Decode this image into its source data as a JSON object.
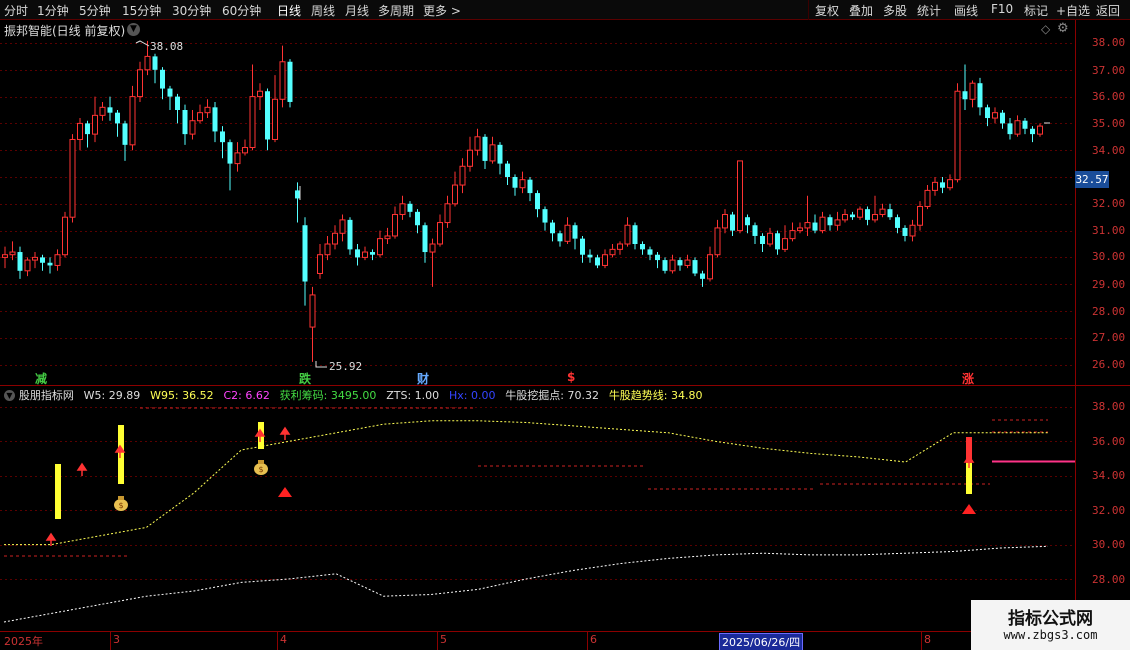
{
  "toolbar": {
    "periods": [
      "分时",
      "1分钟",
      "5分钟",
      "15分钟",
      "30分钟",
      "60分钟",
      "日线",
      "周线",
      "月线",
      "多周期",
      "更多 >"
    ],
    "active_period": "日线",
    "right_buttons": [
      "复权",
      "叠加",
      "多股",
      "统计",
      "画线",
      "F10",
      "标记",
      "+自选",
      "返回"
    ]
  },
  "main_chart": {
    "title": "振邦智能(日线 前复权)",
    "high_label": "38.08",
    "low_label": "25.92",
    "current_price": "32.57",
    "y_ticks": [
      "38.00",
      "37.00",
      "36.00",
      "35.00",
      "34.00",
      "33.00",
      "32.00",
      "31.00",
      "30.00",
      "29.00",
      "28.00",
      "27.00",
      "26.00"
    ],
    "markers": [
      {
        "text": "减",
        "color": "#44cc44"
      },
      {
        "text": "跌",
        "color": "#44cc44"
      },
      {
        "text": "财",
        "color": "#66aaff"
      },
      {
        "text": "$",
        "color": "#ff3333"
      },
      {
        "text": "涨",
        "color": "#ff3333"
      }
    ]
  },
  "indicator": {
    "name": "股朋指标网",
    "items": [
      {
        "text": "W5: 29.89",
        "color": "#dddddd"
      },
      {
        "text": "W95: 36.52",
        "color": "#ffff55"
      },
      {
        "text": "C2: 6.62",
        "color": "#ff44ff"
      },
      {
        "text": "获利筹码: 3495.00",
        "color": "#44dd44"
      },
      {
        "text": "ZTS: 1.00",
        "color": "#dddddd"
      },
      {
        "text": "Hx: 0.00",
        "color": "#3344ff"
      },
      {
        "text": "牛股挖掘点: 70.32",
        "color": "#dddddd"
      },
      {
        "text": "牛股趋势线: 34.80",
        "color": "#ffff55"
      }
    ],
    "y_ticks": [
      "38.00",
      "36.00",
      "34.00",
      "32.00",
      "30.00",
      "28.00"
    ]
  },
  "dates": {
    "labels": [
      "2025年",
      "3",
      "4",
      "5",
      "6",
      "8"
    ],
    "selected": "2025/06/26/四"
  },
  "watermark": {
    "title": "指标公式网",
    "url": "www.zbgs3.com"
  },
  "chart_data": {
    "type": "candlestick",
    "title": "振邦智能(日线 前复权)",
    "ylim": [
      25.5,
      38.5
    ],
    "up_color": "#ff3333",
    "down_color": "#54ffff",
    "candles": [
      [
        30.0,
        30.1,
        29.6,
        30.4
      ],
      [
        30.1,
        30.2,
        29.9,
        30.6
      ],
      [
        30.2,
        29.5,
        29.2,
        30.4
      ],
      [
        29.5,
        29.9,
        29.3,
        30.0
      ],
      [
        29.9,
        30.0,
        29.6,
        30.2
      ],
      [
        30.0,
        29.8,
        29.5,
        30.1
      ],
      [
        29.8,
        29.7,
        29.4,
        30.0
      ],
      [
        29.7,
        30.1,
        29.5,
        30.3
      ],
      [
        30.1,
        31.5,
        30.0,
        31.7
      ],
      [
        31.5,
        34.4,
        31.3,
        34.6
      ],
      [
        34.4,
        35.0,
        34.0,
        35.2
      ],
      [
        35.0,
        34.6,
        34.1,
        35.1
      ],
      [
        34.6,
        35.3,
        34.3,
        36.0
      ],
      [
        35.3,
        35.6,
        35.1,
        35.8
      ],
      [
        35.6,
        35.4,
        35.1,
        36.0
      ],
      [
        35.4,
        35.0,
        34.5,
        35.5
      ],
      [
        35.0,
        34.2,
        33.6,
        35.1
      ],
      [
        34.2,
        36.0,
        34.0,
        36.4
      ],
      [
        36.0,
        37.0,
        35.8,
        37.3
      ],
      [
        37.0,
        37.5,
        36.8,
        38.08
      ],
      [
        37.5,
        37.0,
        36.5,
        37.6
      ],
      [
        37.0,
        36.3,
        35.9,
        37.1
      ],
      [
        36.3,
        36.0,
        35.5,
        36.4
      ],
      [
        36.0,
        35.5,
        35.0,
        36.1
      ],
      [
        35.5,
        34.6,
        34.2,
        35.7
      ],
      [
        34.6,
        35.1,
        34.4,
        35.5
      ],
      [
        35.1,
        35.4,
        35.0,
        35.7
      ],
      [
        35.4,
        35.6,
        35.2,
        35.9
      ],
      [
        35.6,
        34.7,
        34.3,
        35.8
      ],
      [
        34.7,
        34.3,
        33.7,
        34.9
      ],
      [
        34.3,
        33.5,
        32.5,
        34.4
      ],
      [
        33.5,
        33.9,
        33.2,
        34.3
      ],
      [
        33.9,
        34.1,
        33.8,
        34.4
      ],
      [
        34.1,
        36.0,
        34.0,
        37.2
      ],
      [
        36.0,
        36.2,
        35.5,
        36.5
      ],
      [
        36.2,
        34.4,
        34.0,
        36.3
      ],
      [
        34.4,
        35.9,
        34.3,
        36.8
      ],
      [
        35.9,
        37.3,
        35.6,
        37.9
      ],
      [
        37.3,
        35.8,
        35.6,
        37.4
      ],
      [
        32.5,
        32.2,
        31.3,
        32.8
      ],
      [
        31.2,
        29.1,
        28.2,
        31.5
      ],
      [
        27.4,
        28.6,
        26.1,
        28.9
      ],
      [
        29.4,
        30.1,
        29.2,
        30.5
      ],
      [
        30.1,
        30.5,
        29.9,
        30.8
      ],
      [
        30.5,
        30.9,
        30.3,
        31.2
      ],
      [
        30.9,
        31.4,
        30.6,
        31.6
      ],
      [
        31.4,
        30.3,
        30.1,
        31.5
      ],
      [
        30.3,
        30.0,
        29.7,
        30.5
      ],
      [
        30.0,
        30.2,
        29.9,
        30.4
      ],
      [
        30.2,
        30.1,
        29.9,
        30.3
      ],
      [
        30.1,
        30.7,
        30.0,
        31.0
      ],
      [
        30.7,
        30.8,
        30.5,
        31.1
      ],
      [
        30.8,
        31.6,
        30.7,
        31.9
      ],
      [
        31.6,
        32.0,
        31.4,
        32.3
      ],
      [
        32.0,
        31.7,
        31.5,
        32.1
      ],
      [
        31.7,
        31.2,
        30.9,
        31.8
      ],
      [
        31.2,
        30.2,
        29.8,
        31.3
      ],
      [
        30.2,
        30.5,
        28.9,
        30.7
      ],
      [
        30.5,
        31.3,
        30.4,
        31.6
      ],
      [
        31.3,
        32.0,
        31.1,
        32.3
      ],
      [
        32.0,
        32.7,
        31.9,
        33.2
      ],
      [
        32.7,
        33.4,
        32.4,
        33.7
      ],
      [
        33.4,
        34.0,
        33.2,
        34.5
      ],
      [
        34.0,
        34.5,
        33.8,
        34.8
      ],
      [
        34.5,
        33.6,
        33.3,
        34.6
      ],
      [
        33.6,
        34.2,
        33.5,
        34.5
      ],
      [
        34.2,
        33.5,
        33.1,
        34.3
      ],
      [
        33.5,
        33.0,
        32.7,
        33.6
      ],
      [
        33.0,
        32.6,
        32.3,
        33.1
      ],
      [
        32.6,
        32.9,
        32.4,
        33.2
      ],
      [
        32.9,
        32.4,
        32.1,
        33.0
      ],
      [
        32.4,
        31.8,
        31.5,
        32.5
      ],
      [
        31.8,
        31.3,
        31.0,
        31.9
      ],
      [
        31.3,
        30.9,
        30.6,
        31.4
      ],
      [
        30.9,
        30.6,
        30.4,
        31.0
      ],
      [
        30.6,
        31.2,
        30.5,
        31.5
      ],
      [
        31.2,
        30.7,
        30.3,
        31.3
      ],
      [
        30.7,
        30.1,
        29.8,
        30.8
      ],
      [
        30.1,
        30.0,
        29.8,
        30.3
      ],
      [
        30.0,
        29.7,
        29.6,
        30.1
      ],
      [
        29.7,
        30.1,
        29.6,
        30.3
      ],
      [
        30.1,
        30.3,
        30.0,
        30.5
      ],
      [
        30.3,
        30.5,
        30.1,
        30.6
      ],
      [
        30.5,
        31.2,
        30.4,
        31.5
      ],
      [
        31.2,
        30.5,
        30.3,
        31.3
      ],
      [
        30.5,
        30.3,
        30.1,
        30.6
      ],
      [
        30.3,
        30.1,
        29.9,
        30.4
      ],
      [
        30.1,
        29.9,
        29.6,
        30.2
      ],
      [
        29.9,
        29.5,
        29.4,
        30.0
      ],
      [
        29.5,
        29.9,
        29.4,
        30.1
      ],
      [
        29.9,
        29.7,
        29.5,
        30.0
      ],
      [
        29.7,
        29.9,
        29.6,
        30.1
      ],
      [
        29.9,
        29.4,
        29.3,
        30.0
      ],
      [
        29.4,
        29.2,
        28.9,
        29.5
      ],
      [
        29.2,
        30.1,
        29.1,
        30.4
      ],
      [
        30.1,
        31.1,
        30.0,
        31.4
      ],
      [
        31.1,
        31.6,
        30.9,
        31.8
      ],
      [
        31.6,
        31.0,
        30.8,
        31.7
      ],
      [
        31.0,
        33.6,
        30.9,
        33.6
      ],
      [
        31.5,
        31.2,
        30.9,
        31.6
      ],
      [
        31.2,
        30.8,
        30.5,
        31.3
      ],
      [
        30.8,
        30.5,
        30.2,
        30.9
      ],
      [
        30.5,
        30.9,
        30.4,
        31.1
      ],
      [
        30.9,
        30.3,
        30.1,
        31.0
      ],
      [
        30.3,
        30.7,
        30.2,
        31.2
      ],
      [
        30.7,
        31.0,
        30.6,
        31.3
      ],
      [
        31.0,
        31.1,
        30.9,
        31.3
      ],
      [
        31.1,
        31.3,
        30.8,
        32.3
      ],
      [
        31.3,
        31.0,
        30.9,
        31.6
      ],
      [
        31.0,
        31.5,
        30.9,
        31.7
      ],
      [
        31.5,
        31.2,
        31.0,
        31.6
      ],
      [
        31.2,
        31.4,
        31.0,
        31.7
      ],
      [
        31.4,
        31.6,
        31.3,
        31.8
      ],
      [
        31.6,
        31.5,
        31.4,
        31.7
      ],
      [
        31.5,
        31.8,
        31.4,
        31.9
      ],
      [
        31.8,
        31.4,
        31.2,
        31.9
      ],
      [
        31.4,
        31.6,
        31.3,
        32.3
      ],
      [
        31.6,
        31.8,
        31.5,
        32.0
      ],
      [
        31.8,
        31.5,
        31.4,
        32.0
      ],
      [
        31.5,
        31.1,
        30.9,
        31.6
      ],
      [
        31.1,
        30.8,
        30.6,
        31.2
      ],
      [
        30.8,
        31.2,
        30.6,
        31.4
      ],
      [
        31.2,
        31.9,
        31.0,
        32.1
      ],
      [
        31.9,
        32.5,
        31.8,
        32.7
      ],
      [
        32.5,
        32.8,
        32.3,
        33.0
      ],
      [
        32.8,
        32.6,
        32.4,
        33.0
      ],
      [
        32.6,
        32.9,
        32.5,
        33.1
      ],
      [
        32.9,
        36.2,
        32.8,
        36.5
      ],
      [
        36.2,
        35.9,
        35.5,
        37.2
      ],
      [
        35.9,
        36.5,
        35.6,
        36.6
      ],
      [
        36.5,
        35.6,
        35.3,
        36.7
      ],
      [
        35.6,
        35.2,
        34.9,
        35.7
      ],
      [
        35.2,
        35.4,
        35.0,
        35.6
      ],
      [
        35.4,
        35.0,
        34.8,
        35.5
      ],
      [
        35.0,
        34.6,
        34.4,
        35.2
      ],
      [
        34.6,
        35.1,
        34.5,
        35.3
      ],
      [
        35.1,
        34.8,
        34.6,
        35.2
      ],
      [
        34.8,
        34.6,
        34.3,
        34.9
      ],
      [
        34.6,
        34.9,
        34.5,
        35.0
      ]
    ],
    "indicator_series": [
      {
        "name": "W95",
        "color": "#ffff55",
        "values": [
          30.0,
          30.0,
          30.5,
          31.0,
          33.0,
          35.5,
          36.0,
          36.5,
          37.0,
          37.2,
          37.2,
          37.1,
          36.9,
          36.7,
          36.5,
          36.0,
          35.6,
          35.3,
          35.1,
          34.8,
          36.5,
          36.5,
          36.5
        ]
      },
      {
        "name": "W5",
        "color": "#ffffff",
        "values": [
          25.5,
          26.0,
          26.5,
          27.0,
          27.3,
          27.8,
          28.0,
          28.3,
          27.0,
          27.1,
          27.4,
          28.0,
          28.5,
          28.9,
          29.2,
          29.4,
          29.5,
          29.4,
          29.4,
          29.5,
          29.6,
          29.8,
          29.9
        ]
      }
    ]
  }
}
